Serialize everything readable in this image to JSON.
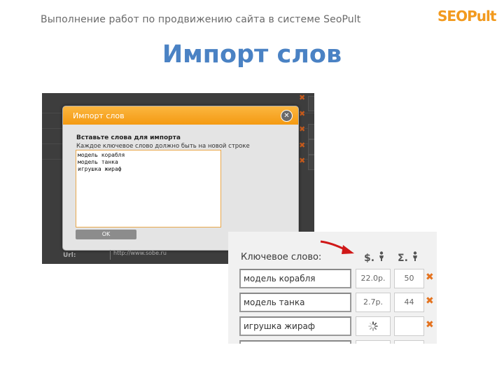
{
  "header": {
    "subtitle": "Выполнение работ по продвижению сайта в системе SeoPult",
    "logo_text": "SEOPult",
    "logo_icon": "seopult-logo-icon",
    "title": "Импорт слов"
  },
  "colors": {
    "title": "#4a82c4",
    "logo": "#f29a1f",
    "modal_header": "#f49a12",
    "delete_icon": "#e4731f"
  },
  "background_screenshot": {
    "row_label": "Url:",
    "row_value": "http://www.sobe.ru"
  },
  "modal": {
    "title": "Импорт слов",
    "close_icon": "close-icon",
    "label": "Вставьте слова для импорта",
    "hint": "Каждое ключевое слово должно быть на новой строке",
    "textarea_lines": [
      "модель корабля",
      "модель танка",
      "игрушка жираф"
    ],
    "ok_label": "OK"
  },
  "keyword_panel": {
    "label": "Ключевое слово:",
    "price_header": "$.",
    "count_header": "Σ.",
    "price_header_icon": "person-icon",
    "count_header_icon": "person-icon",
    "arrow_icon": "red-arrow-icon",
    "delete_icon": "delete-x-icon",
    "rows": [
      {
        "keyword": "модель корабля",
        "price": "22.0р.",
        "count": "50",
        "loading": false
      },
      {
        "keyword": "модель танка",
        "price": "2.7р.",
        "count": "44",
        "loading": false
      },
      {
        "keyword": "игрушка жираф",
        "price": "",
        "count": "",
        "loading": true
      },
      {
        "keyword": "",
        "price": "",
        "count": "",
        "loading": false
      }
    ]
  }
}
